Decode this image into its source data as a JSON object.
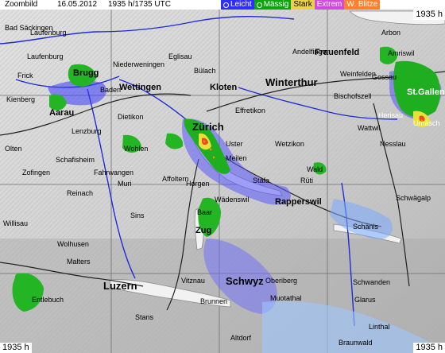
{
  "header": {
    "zoom_label": "Zoombild",
    "date": "16.05.2012",
    "time": "1935 h/1735 UTC"
  },
  "legend": [
    {
      "label": "Leicht",
      "color": "#2e2eff"
    },
    {
      "label": "Mässig",
      "color": "#0aa50a"
    },
    {
      "label": "Stark",
      "color": "#ecd24a"
    },
    {
      "label": "Extrem",
      "color": "#d04adf"
    },
    {
      "label": "W. Blitze",
      "color": "#ff7f2a"
    }
  ],
  "corners": {
    "top_right": "1935 h",
    "bottom_left": "1935 h",
    "bottom_right": "1935 h"
  },
  "places": [
    "Bad Säckingen",
    "Laufenburg",
    "Laufenburg",
    "Frick",
    "Niederweningen",
    "Brugg",
    "Baden",
    "Wettingen",
    "Aarau",
    "Kienberg",
    "Dietikon",
    "Lenzburg",
    "Olten",
    "Wohlen",
    "Schafisheim",
    "Zofingen",
    "Fahrwangen",
    "Muri",
    "Reinach",
    "Willisau",
    "Affoltern",
    "Sins",
    "Wolhusen",
    "Malters",
    "Luzern",
    "Entlebuch",
    "Eglisau",
    "Bülach",
    "Kloten",
    "Zürich",
    "Effretikon",
    "Winterthur",
    "Andelfingen",
    "Uster",
    "Wetzikon",
    "Meilen",
    "Stäfa",
    "Horgen",
    "Wädenswil",
    "Rapperswil",
    "Rüti",
    "Baar",
    "Zug",
    "Schwyz",
    "Oberiberg",
    "Brunnen",
    "Muotathal",
    "Vitznau",
    "Bischofszell",
    "Weinfelden",
    "Frauenfeld",
    "Arbon",
    "Amriswil",
    "Gossau",
    "St.Gallen",
    "Herisau",
    "Urnäsch",
    "Wattwil",
    "Nesslau",
    "Wald",
    "Schwägalp",
    "Schänis",
    "Schwanden",
    "Glarus",
    "Linthal",
    "Stans",
    "Altdorf",
    "Braunwald"
  ]
}
